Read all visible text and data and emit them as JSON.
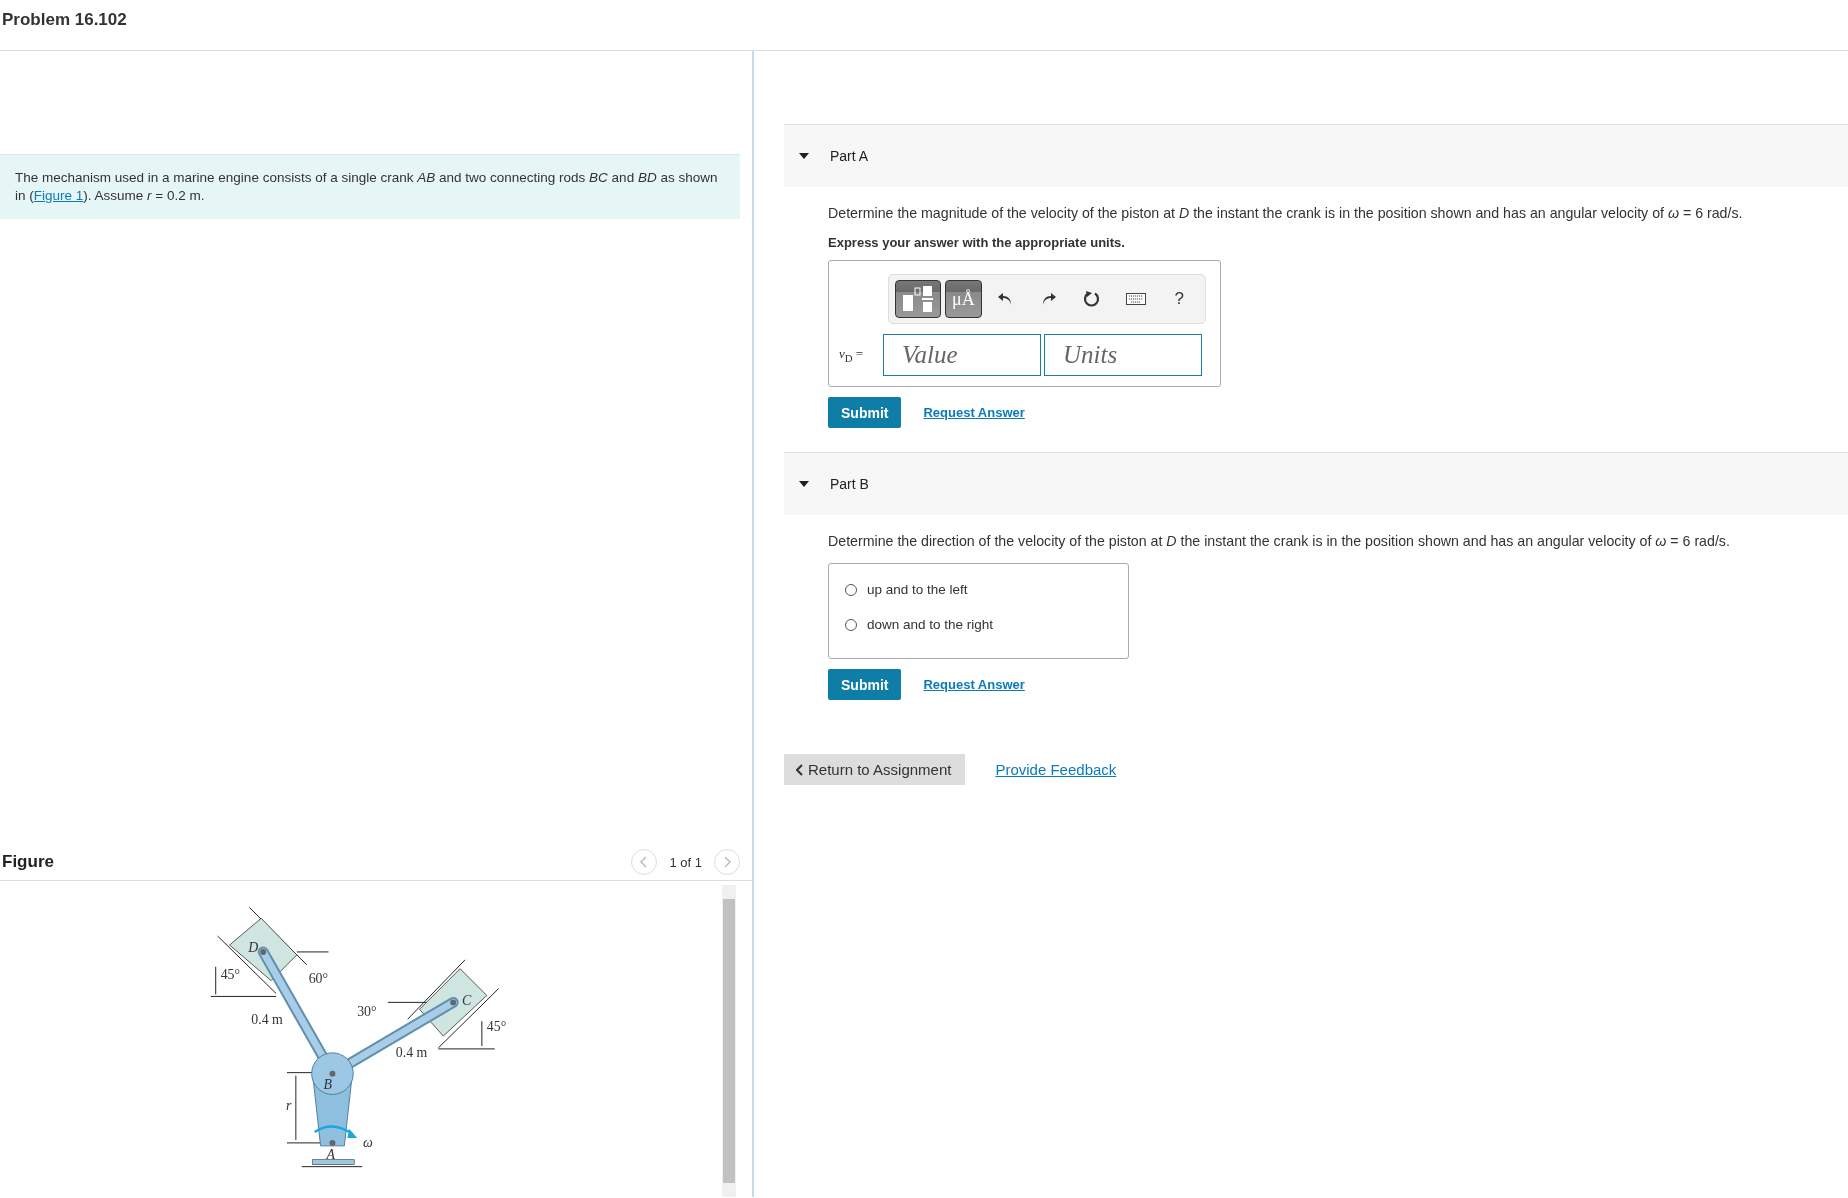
{
  "header": {
    "title": "Problem 16.102"
  },
  "problem": {
    "text_before": "The mechanism used in a marine engine consists of a single crank *AB* and two connecting rods *BC* and *BD* as shown in (",
    "link": "Figure 1",
    "text_after": "). Assume *r* = 0.2 m."
  },
  "figure": {
    "title": "Figure",
    "pager": "1 of 1",
    "labels": [
      "D",
      "45°",
      "60°",
      "0.4 m",
      "30°",
      "C",
      "45°",
      "0.4 m",
      "B",
      "r",
      "ω",
      "A"
    ]
  },
  "parts": [
    {
      "kind": "answer",
      "title": "Part A",
      "expanded": true,
      "prompt": "Determine the magnitude of the velocity of the piston at *D* the instant the crank is in the position shown and has an angular velocity of *ω* = 6 rad/s.",
      "instruction": "Express your answer with the appropriate units.",
      "units_button": "μÅ",
      "help": "?",
      "variable": "*v*$_{D}$ =",
      "value_placeholder": "Value",
      "units_placeholder": "Units",
      "submit": "Submit",
      "request": "Request Answer"
    },
    {
      "kind": "choice",
      "title": "Part B",
      "expanded": true,
      "prompt": "Determine the direction of the velocity of the piston at *D* the instant the crank is in the position shown and has an angular velocity of *ω* = 6 rad/s.",
      "options": [
        {
          "label": "up and to the left",
          "selected": false
        },
        {
          "label": "down and to the right",
          "selected": false
        }
      ],
      "submit": "Submit",
      "request": "Request Answer"
    }
  ],
  "footer": {
    "return": "Return to Assignment",
    "feedback": "Provide Feedback"
  }
}
